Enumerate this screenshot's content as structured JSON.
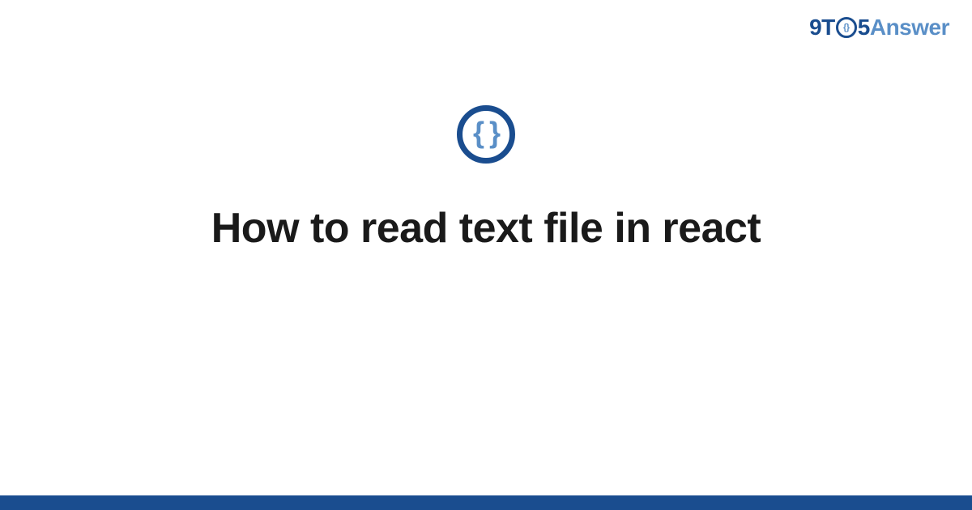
{
  "brand": {
    "part1": "9T",
    "circle_inner": "{}",
    "part2": "5",
    "part3": "Answer"
  },
  "center_icon": {
    "braces": "{ }"
  },
  "title": "How to read text file in react",
  "colors": {
    "primary": "#1a4d8f",
    "secondary": "#5a8fc7",
    "text": "#1a1a1a"
  }
}
